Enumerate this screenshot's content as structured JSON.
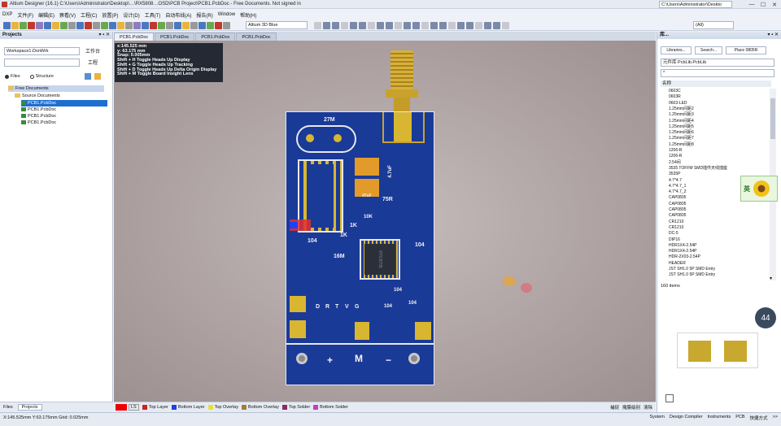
{
  "window": {
    "title": "Altium Designer (16.1)   C:\\Users\\Administrator\\Desktop\\…\\RX5808…OSD\\PCB Project\\PCB1.PcbDoc - Free Documents. Not signed in",
    "path_field": "C:\\Users\\Administrator\\Deskto",
    "minimize": "—",
    "maximize": "☐",
    "close": "✕"
  },
  "menu": [
    "DXP",
    "文件(F)",
    "编辑(E)",
    "察看(V)",
    "工程(C)",
    "放置(P)",
    "设计(D)",
    "工具(T)",
    "自动布线(A)",
    "报告(R)",
    "Window",
    "帮助(H)"
  ],
  "toolbar": {
    "view_mode": "Altium 3D Blue",
    "dropdown2": "(All)"
  },
  "projects_panel": {
    "title": "Projects",
    "workspace": "Workspace1.DsnWrk",
    "workspace_btn": "工作台",
    "project_btn": "工程",
    "view_files": "Files",
    "view_structure": "Structure",
    "tree": [
      {
        "label": "Free Documents",
        "level": 0,
        "type": "folder"
      },
      {
        "label": "Source Documents",
        "level": 1,
        "type": "folder"
      },
      {
        "label": "PCB1.PcbDoc",
        "level": 2,
        "type": "pcb",
        "selected": true
      },
      {
        "label": "PCB1.PcbDoc",
        "level": 2,
        "type": "pcb"
      },
      {
        "label": "PCB1.PcbDoc",
        "level": 2,
        "type": "pcb"
      },
      {
        "label": "PCB1.PcbDoc",
        "level": 2,
        "type": "pcb"
      }
    ],
    "bottom_tabs": [
      "Files",
      "Projects"
    ]
  },
  "doc_tabs": [
    "PCB1.PcbDoc",
    "PCB1.PcbDoc",
    "PCB1.PcbDoc",
    "PCB1.PcbDoc"
  ],
  "hud": {
    "x": "x:145.525 mm",
    "y": "y: 63.175  mm",
    "snap": "Snap: 0.005mm",
    "lines": [
      "Shift + H  Toggle Heads Up Display",
      "Shift + G  Toggle Heads Up Tracking",
      "Shift + D  Toggle Heads Up Delta Origin Display",
      "Shift + M  Toggle Board Insight Lens"
    ]
  },
  "pcb": {
    "labels": [
      "27M",
      "4.7uF",
      "47uF",
      "75R",
      "10K",
      "1K",
      "1K",
      "104",
      "16M",
      "104",
      "104",
      "104",
      "104",
      "D",
      "R",
      "T",
      "V",
      "G",
      "+",
      "M",
      "−"
    ],
    "chip_marking": "RTC6705"
  },
  "layers": [
    {
      "name": "Top Layer",
      "color": "#d22020"
    },
    {
      "name": "Bottom Layer",
      "color": "#2040e0"
    },
    {
      "name": "Top Overlay",
      "color": "#e8e040"
    },
    {
      "name": "Bottom Overlay",
      "color": "#a08030"
    },
    {
      "name": "Top Solder",
      "color": "#8a2a6a"
    },
    {
      "name": "Bottom Solder",
      "color": "#c040c0"
    }
  ],
  "layerbar_tail": [
    "捕捉",
    "掩膜级别",
    "清除"
  ],
  "libraries_panel": {
    "title": "库...",
    "btn_libraries": "Libraries...",
    "btn_search": "Search...",
    "btn_place": "Place 0805R",
    "library_select": "元件库 PcbLib.PcbLib",
    "filter": "*",
    "col_header": "名称",
    "items": [
      "0603C",
      "0603R",
      "0603-LED",
      "1.25mm间距2",
      "1.25mm间距3",
      "1.25mm间距4",
      "1.25mm间距5",
      "1.25mm间距6",
      "1.25mm间距7",
      "1.25mm间距8",
      "1206-R",
      "1206-R",
      "2.54间",
      "3535 TOFFM SMD插件天线插座",
      "3535P",
      "4.7*4.7",
      "4.7*4.7_1",
      "4.7*4.7_2",
      "CAP0805",
      "CAP0805",
      "CAP0805",
      "CAP0805",
      "CR1210",
      "CR1210",
      "DC-5",
      "DIP16",
      "HDR1X4-2.54P",
      "HDR1X4-2.54P",
      "HDR-2X03-2.54P",
      "HEADER",
      "JST SH1.0 5P SMD Entry",
      "JST SH1.0 5P SMD Entry"
    ],
    "count_footer": "160 items",
    "zoom_badge": "44"
  },
  "status": {
    "coords": "X:145.525mm Y:63.175mm   Grid: 0.025mm",
    "right_items": [
      "System",
      "Design Compiler",
      "Instruments",
      "PCB",
      "快捷方式",
      ">>"
    ]
  },
  "ime": {
    "label": "英"
  }
}
